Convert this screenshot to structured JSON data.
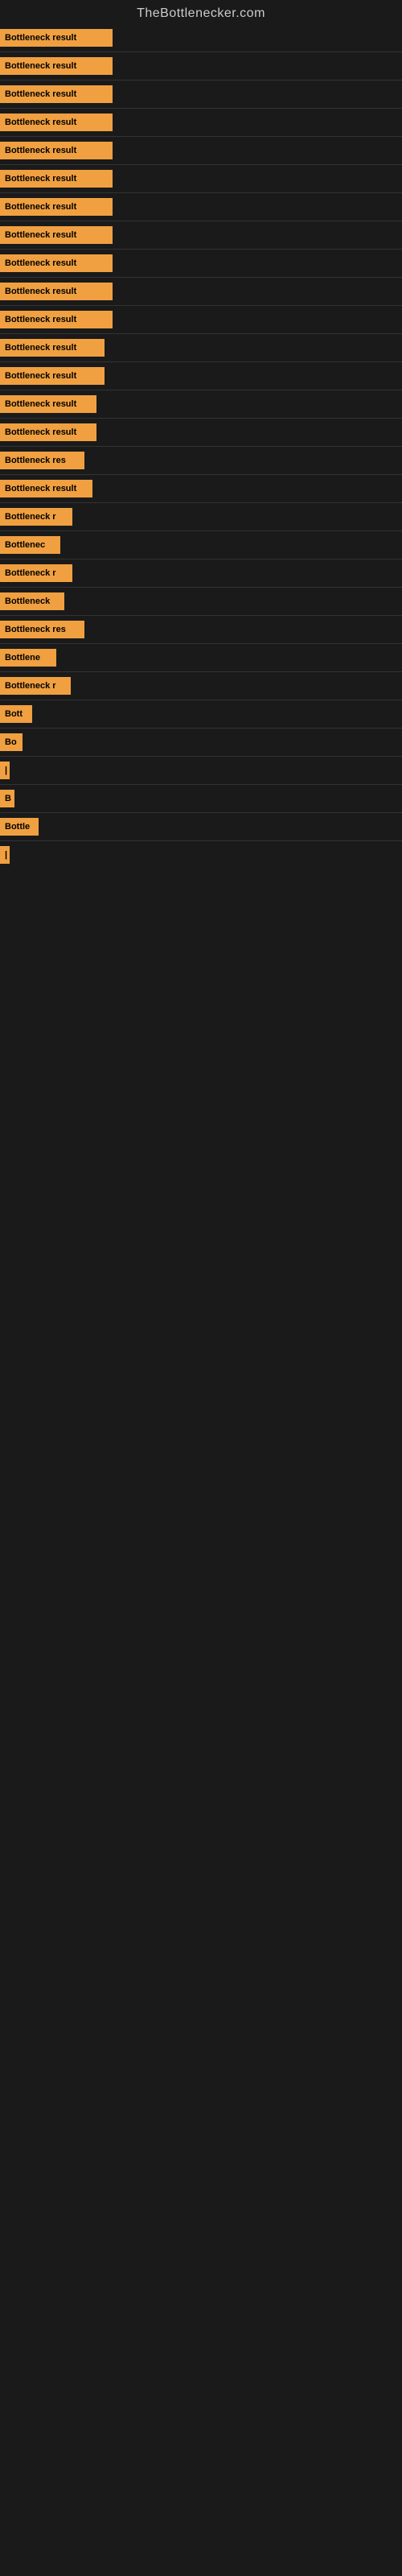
{
  "site": {
    "title": "TheBottlenecker.com"
  },
  "bars": [
    {
      "label": "Bottleneck result",
      "width": 140
    },
    {
      "label": "Bottleneck result",
      "width": 140
    },
    {
      "label": "Bottleneck result",
      "width": 140
    },
    {
      "label": "Bottleneck result",
      "width": 140
    },
    {
      "label": "Bottleneck result",
      "width": 140
    },
    {
      "label": "Bottleneck result",
      "width": 140
    },
    {
      "label": "Bottleneck result",
      "width": 140
    },
    {
      "label": "Bottleneck result",
      "width": 140
    },
    {
      "label": "Bottleneck result",
      "width": 140
    },
    {
      "label": "Bottleneck result",
      "width": 140
    },
    {
      "label": "Bottleneck result",
      "width": 140
    },
    {
      "label": "Bottleneck result",
      "width": 130
    },
    {
      "label": "Bottleneck result",
      "width": 130
    },
    {
      "label": "Bottleneck result",
      "width": 120
    },
    {
      "label": "Bottleneck result",
      "width": 120
    },
    {
      "label": "Bottleneck res",
      "width": 105
    },
    {
      "label": "Bottleneck result",
      "width": 115
    },
    {
      "label": "Bottleneck r",
      "width": 90
    },
    {
      "label": "Bottlenec",
      "width": 75
    },
    {
      "label": "Bottleneck r",
      "width": 90
    },
    {
      "label": "Bottleneck",
      "width": 80
    },
    {
      "label": "Bottleneck res",
      "width": 105
    },
    {
      "label": "Bottlene",
      "width": 70
    },
    {
      "label": "Bottleneck r",
      "width": 88
    },
    {
      "label": "Bott",
      "width": 40
    },
    {
      "label": "Bo",
      "width": 28
    },
    {
      "label": "|",
      "width": 10
    },
    {
      "label": "B",
      "width": 18
    },
    {
      "label": "Bottle",
      "width": 48
    },
    {
      "label": "|",
      "width": 10
    }
  ]
}
